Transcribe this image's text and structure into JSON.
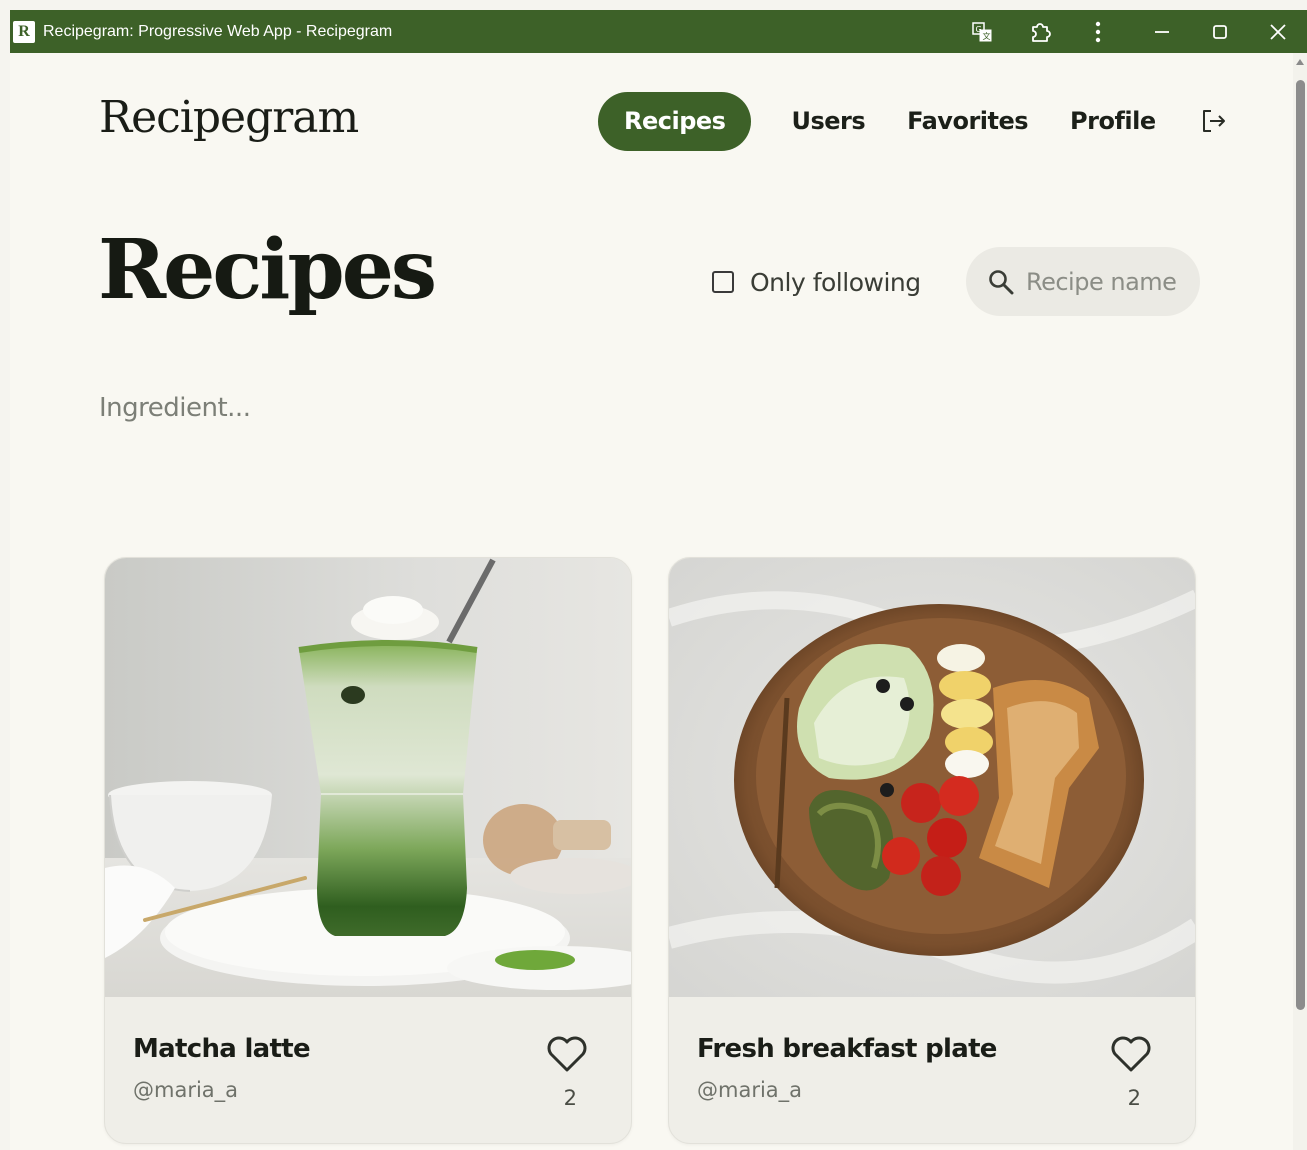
{
  "window": {
    "app_icon_letter": "R",
    "title": "Recipegram: Progressive Web App - Recipegram",
    "colors": {
      "titlebar": "#3d6128",
      "accent": "#3d6128",
      "background": "#f9f8f2"
    },
    "controls": [
      "translate-icon",
      "extensions-icon",
      "more-icon",
      "minimize-icon",
      "maximize-icon",
      "close-icon"
    ]
  },
  "header": {
    "logo": "Recipegram",
    "nav": {
      "recipes": "Recipes",
      "users": "Users",
      "favorites": "Favorites",
      "profile": "Profile"
    },
    "logout_icon": "logout-icon"
  },
  "main": {
    "title": "Recipes",
    "only_following_label": "Only following",
    "only_following_checked": false,
    "search": {
      "placeholder": "Recipe name",
      "value": ""
    },
    "ingredient": {
      "placeholder": "Ingredient...",
      "value": ""
    }
  },
  "recipes": [
    {
      "title": "Matcha latte",
      "author": "@maria_a",
      "likes": "2"
    },
    {
      "title": "Fresh breakfast plate",
      "author": "@maria_a",
      "likes": "2"
    }
  ]
}
